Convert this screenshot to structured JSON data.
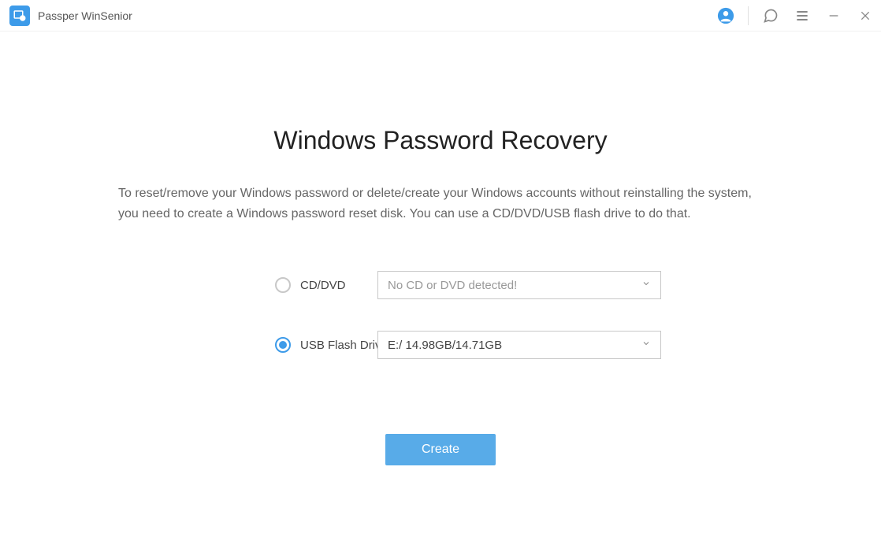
{
  "header": {
    "title": "Passper WinSenior"
  },
  "main": {
    "title": "Windows Password Recovery",
    "description": "To reset/remove your Windows password or delete/create your Windows accounts without reinstalling the system, you need to create a Windows password reset disk. You can use a CD/DVD/USB flash drive to do that."
  },
  "options": {
    "cd_dvd": {
      "label": "CD/DVD",
      "selected": false,
      "dropdown_text": "No CD or DVD detected!"
    },
    "usb": {
      "label": "USB Flash Drive",
      "selected": true,
      "dropdown_text": "E:/ 14.98GB/14.71GB"
    }
  },
  "button": {
    "create_label": "Create"
  }
}
